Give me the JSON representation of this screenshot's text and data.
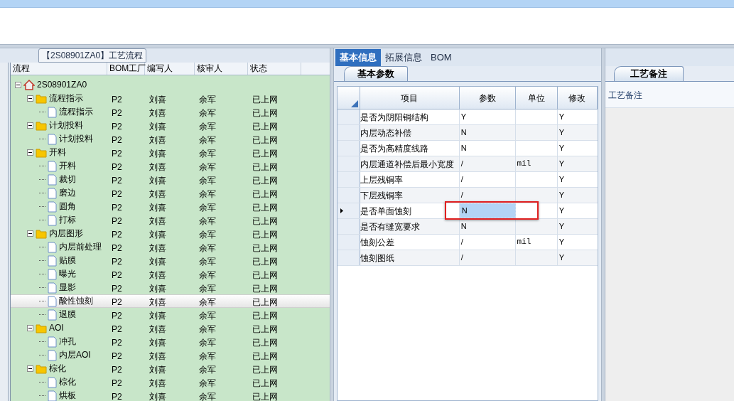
{
  "flow_panel": {
    "title": "【2S08901ZA0】工艺流程",
    "columns": [
      "流程",
      "BOM工厂",
      "编写人",
      "核审人",
      "状态"
    ],
    "tree": [
      {
        "kind": "root",
        "name": "2S08901ZA0",
        "expanded": true,
        "selected": false,
        "children": [
          {
            "kind": "folder",
            "name": "流程指示",
            "expanded": true,
            "selected": false,
            "bom": "P2",
            "writer": "刘喜",
            "reviewer": "余军",
            "status": "已上网",
            "children": [
              {
                "kind": "file",
                "name": "流程指示",
                "selected": false,
                "bom": "P2",
                "writer": "刘喜",
                "reviewer": "余军",
                "status": "已上网"
              }
            ]
          },
          {
            "kind": "folder",
            "name": "计划投料",
            "expanded": true,
            "selected": false,
            "bom": "P2",
            "writer": "刘喜",
            "reviewer": "余军",
            "status": "已上网",
            "children": [
              {
                "kind": "file",
                "name": "计划投料",
                "selected": false,
                "bom": "P2",
                "writer": "刘喜",
                "reviewer": "余军",
                "status": "已上网"
              }
            ]
          },
          {
            "kind": "folder",
            "name": "开料",
            "expanded": true,
            "selected": false,
            "bom": "P2",
            "writer": "刘喜",
            "reviewer": "余军",
            "status": "已上网",
            "children": [
              {
                "kind": "file",
                "name": "开料",
                "selected": false,
                "bom": "P2",
                "writer": "刘喜",
                "reviewer": "余军",
                "status": "已上网"
              },
              {
                "kind": "file",
                "name": "裁切",
                "selected": false,
                "bom": "P2",
                "writer": "刘喜",
                "reviewer": "余军",
                "status": "已上网"
              },
              {
                "kind": "file",
                "name": "磨边",
                "selected": false,
                "bom": "P2",
                "writer": "刘喜",
                "reviewer": "余军",
                "status": "已上网"
              },
              {
                "kind": "file",
                "name": "圆角",
                "selected": false,
                "bom": "P2",
                "writer": "刘喜",
                "reviewer": "余军",
                "status": "已上网"
              },
              {
                "kind": "file",
                "name": "打标",
                "selected": false,
                "bom": "P2",
                "writer": "刘喜",
                "reviewer": "余军",
                "status": "已上网"
              }
            ]
          },
          {
            "kind": "folder",
            "name": "内层图形",
            "expanded": true,
            "selected": false,
            "bom": "P2",
            "writer": "刘喜",
            "reviewer": "余军",
            "status": "已上网",
            "children": [
              {
                "kind": "file",
                "name": "内层前处理",
                "selected": false,
                "bom": "P2",
                "writer": "刘喜",
                "reviewer": "余军",
                "status": "已上网"
              },
              {
                "kind": "file",
                "name": "贴膜",
                "selected": false,
                "bom": "P2",
                "writer": "刘喜",
                "reviewer": "余军",
                "status": "已上网"
              },
              {
                "kind": "file",
                "name": "曝光",
                "selected": false,
                "bom": "P2",
                "writer": "刘喜",
                "reviewer": "余军",
                "status": "已上网"
              },
              {
                "kind": "file",
                "name": "显影",
                "selected": false,
                "bom": "P2",
                "writer": "刘喜",
                "reviewer": "余军",
                "status": "已上网"
              },
              {
                "kind": "file",
                "name": "酸性蚀刻",
                "selected": true,
                "bom": "P2",
                "writer": "刘喜",
                "reviewer": "余军",
                "status": "已上网"
              },
              {
                "kind": "file",
                "name": "退膜",
                "selected": false,
                "bom": "P2",
                "writer": "刘喜",
                "reviewer": "余军",
                "status": "已上网"
              }
            ]
          },
          {
            "kind": "folder",
            "name": "AOI",
            "expanded": true,
            "selected": false,
            "bom": "P2",
            "writer": "刘喜",
            "reviewer": "余军",
            "status": "已上网",
            "children": [
              {
                "kind": "file",
                "name": "冲孔",
                "selected": false,
                "bom": "P2",
                "writer": "刘喜",
                "reviewer": "余军",
                "status": "已上网"
              },
              {
                "kind": "file",
                "name": "内层AOI",
                "selected": false,
                "bom": "P2",
                "writer": "刘喜",
                "reviewer": "余军",
                "status": "已上网"
              }
            ]
          },
          {
            "kind": "folder",
            "name": "棕化",
            "expanded": true,
            "selected": false,
            "bom": "P2",
            "writer": "刘喜",
            "reviewer": "余军",
            "status": "已上网",
            "children": [
              {
                "kind": "file",
                "name": "棕化",
                "selected": false,
                "bom": "P2",
                "writer": "刘喜",
                "reviewer": "余军",
                "status": "已上网"
              },
              {
                "kind": "file",
                "name": "烘板",
                "selected": false,
                "bom": "P2",
                "writer": "刘喜",
                "reviewer": "余军",
                "status": "已上网"
              }
            ]
          }
        ]
      }
    ]
  },
  "info_panel": {
    "tabs": [
      {
        "label": "基本信息",
        "selected": true
      },
      {
        "label": "拓展信息",
        "selected": false
      },
      {
        "label": "BOM",
        "selected": false
      }
    ],
    "sub_tab": "基本参数",
    "columns": [
      "项目",
      "参数",
      "单位",
      "修改"
    ],
    "rows": [
      {
        "item": "是否为阴阳铜结构",
        "param": "Y",
        "modify": "Y",
        "selected": false,
        "highlighted": false
      },
      {
        "item": "内层动态补偿",
        "param": "N",
        "modify": "Y",
        "selected": false,
        "highlighted": false
      },
      {
        "item": "是否为高精度线路",
        "param": "N",
        "modify": "Y",
        "selected": false,
        "highlighted": false
      },
      {
        "item": "内层通道补偿后最小宽度",
        "param": "/",
        "unit": "mil",
        "modify": "Y",
        "selected": false,
        "highlighted": false
      },
      {
        "item": "上层残铜率",
        "param": "/",
        "modify": "Y",
        "selected": false,
        "highlighted": false
      },
      {
        "item": "下层残铜率",
        "param": "/",
        "modify": "Y",
        "selected": false,
        "highlighted": false
      },
      {
        "item": "是否单面蚀刻",
        "param": "N",
        "modify": "Y",
        "selected": true,
        "highlighted": true
      },
      {
        "item": "是否有缝宽要求",
        "param": "N",
        "modify": "Y",
        "selected": false,
        "highlighted": false
      },
      {
        "item": "蚀刻公差",
        "param": "/",
        "unit": "mil",
        "modify": "Y",
        "selected": false,
        "highlighted": false
      },
      {
        "item": "蚀刻图纸",
        "param": "/",
        "modify": "Y",
        "selected": false,
        "highlighted": false
      }
    ]
  },
  "notes_panel": {
    "tab": "工艺备注",
    "label": "工艺备注"
  }
}
